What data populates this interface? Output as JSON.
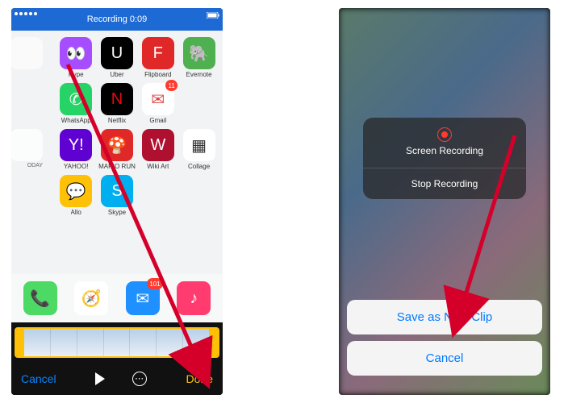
{
  "left": {
    "status": {
      "recording_text": "Recording 0:09"
    },
    "apps": {
      "rows": [
        [
          {
            "label": "Hype",
            "color": "#a64dff",
            "glyph": "👀",
            "badge": null
          },
          {
            "label": "Uber",
            "color": "#000000",
            "glyph": "U",
            "badge": null
          },
          {
            "label": "Flipboard",
            "color": "#e12828",
            "glyph": "F",
            "badge": null
          },
          {
            "label": "Evernote",
            "color": "#4eb04e",
            "glyph": "🐘",
            "badge": null
          }
        ],
        [
          {
            "label": "WhatsApp",
            "color": "#25D366",
            "glyph": "✆",
            "badge": null
          },
          {
            "label": "Netflix",
            "color": "#000000",
            "glyph": "N",
            "fg": "#e50914",
            "badge": null
          },
          {
            "label": "Gmail",
            "color": "#ffffff",
            "glyph": "✉",
            "fg": "#d44",
            "badge": "11"
          }
        ],
        [
          {
            "label": "YAHOO!",
            "color": "#5f01d1",
            "glyph": "Y!",
            "badge": null
          },
          {
            "label": "MARIO RUN",
            "color": "#e12828",
            "glyph": "🍄",
            "badge": null
          },
          {
            "label": "Wiki Art",
            "color": "#b01030",
            "glyph": "W",
            "badge": null
          },
          {
            "label": "Collage",
            "color": "#ffffff",
            "glyph": "▦",
            "fg": "#333",
            "badge": null
          }
        ],
        [
          {
            "label": "Allo",
            "color": "#ffc107",
            "glyph": "💬",
            "badge": null
          },
          {
            "label": "Skype",
            "color": "#00aff0",
            "glyph": "S",
            "badge": null
          }
        ]
      ],
      "row0_prefix": {
        "label": "",
        "color": "#ffffff",
        "glyph": ""
      }
    },
    "dock": [
      {
        "name": "phone",
        "color": "#4cd964",
        "glyph": "📞",
        "badge": null
      },
      {
        "name": "safari",
        "color": "#ffffff",
        "glyph": "🧭",
        "badge": null
      },
      {
        "name": "mail",
        "color": "#1e90ff",
        "glyph": "✉",
        "badge": "101"
      },
      {
        "name": "music",
        "color": "#ff3b6f",
        "glyph": "♪",
        "badge": null
      }
    ],
    "bottom": {
      "cancel": "Cancel",
      "done": "Done"
    }
  },
  "right": {
    "card": {
      "title": "Screen Recording",
      "stop": "Stop Recording"
    },
    "sheet": {
      "save": "Save as New Clip",
      "cancel": "Cancel"
    }
  }
}
